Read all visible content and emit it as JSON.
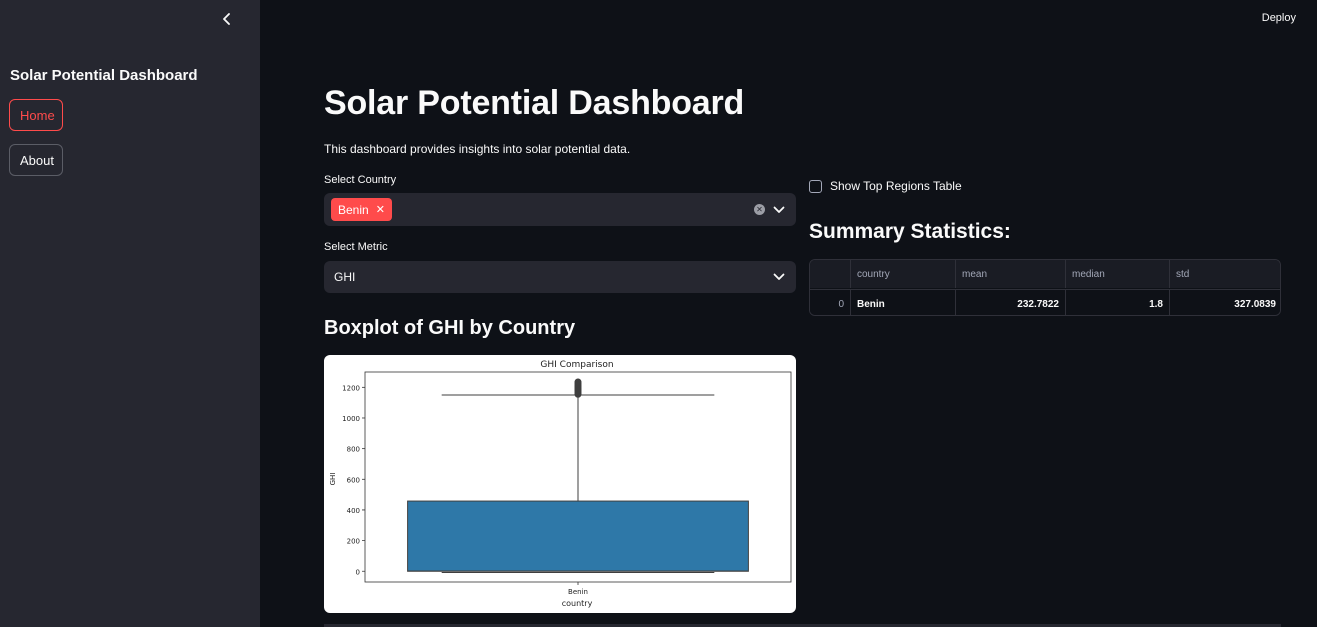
{
  "sidebar": {
    "title": "Solar Potential Dashboard",
    "nav": [
      {
        "label": "Home",
        "active": true
      },
      {
        "label": "About",
        "active": false
      }
    ]
  },
  "header": {
    "deploy_label": "Deploy"
  },
  "main": {
    "title": "Solar Potential Dashboard",
    "description": "This dashboard provides insights into solar potential data.",
    "country_select": {
      "label": "Select Country",
      "selected": [
        "Benin"
      ]
    },
    "metric_select": {
      "label": "Select Metric",
      "value": "GHI"
    },
    "boxplot_heading": "Boxplot of GHI by Country"
  },
  "chart_data": {
    "type": "boxplot",
    "title": "GHI Comparison",
    "xlabel": "country",
    "ylabel": "GHI",
    "categories": [
      "Benin"
    ],
    "yticks": [
      0,
      200,
      400,
      600,
      800,
      1000,
      1200
    ],
    "ylim": [
      -70,
      1300
    ],
    "box": {
      "whisker_low": -8,
      "q1": 0,
      "median": 2,
      "q3": 458,
      "whisker_high": 1150
    },
    "outliers": [
      1155,
      1165,
      1175,
      1185,
      1195,
      1205,
      1215,
      1225,
      1235
    ],
    "color": "#2e78a8"
  },
  "right": {
    "checkbox_label": "Show Top Regions Table",
    "stats_title": "Summary Statistics:",
    "table": {
      "columns": [
        "",
        "country",
        "mean",
        "median",
        "std"
      ],
      "rows": [
        [
          "0",
          "Benin",
          "232.7822",
          "1.8",
          "327.0839"
        ]
      ]
    }
  },
  "colors": {
    "accent": "#ff4b4b",
    "background": "#0e1117",
    "sidebar": "#262730"
  }
}
